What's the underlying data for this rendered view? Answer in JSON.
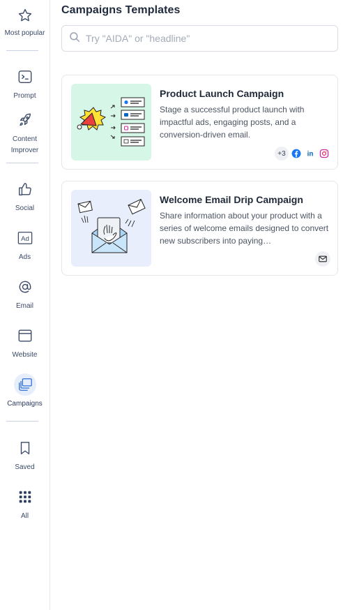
{
  "sidebar": {
    "items": [
      {
        "id": "most-popular",
        "label": "Most popular",
        "icon": "star-icon"
      },
      {
        "id": "prompt",
        "label": "Prompt",
        "icon": "terminal-icon"
      },
      {
        "id": "content-improver",
        "label": "Content Improver",
        "icon": "rocket-icon"
      },
      {
        "id": "social",
        "label": "Social",
        "icon": "thumbs-up-icon"
      },
      {
        "id": "ads",
        "label": "Ads",
        "icon": "ad-icon"
      },
      {
        "id": "email",
        "label": "Email",
        "icon": "at-sign-icon"
      },
      {
        "id": "website",
        "label": "Website",
        "icon": "browser-window-icon"
      },
      {
        "id": "campaigns",
        "label": "Campaigns",
        "icon": "stacked-layers-icon",
        "active": true
      },
      {
        "id": "saved",
        "label": "Saved",
        "icon": "bookmark-icon"
      },
      {
        "id": "all",
        "label": "All",
        "icon": "grid-dots-icon"
      }
    ]
  },
  "main": {
    "title": "Campaigns Templates",
    "search": {
      "placeholder": "Try \"AIDA\" or \"headline\"",
      "value": ""
    },
    "cards": [
      {
        "title": "Product Launch Campaign",
        "description": "Stage a successful product launch with impactful ads, engaging posts, and a conversion-driven email.",
        "more_count": "+3",
        "channels": [
          "facebook-icon",
          "linkedin-icon",
          "instagram-icon"
        ]
      },
      {
        "title": "Welcome Email Drip Campaign",
        "description": "Share information about your product with a series of welcome emails designed to convert new subscribers into paying…",
        "channels": [
          "mail-icon"
        ]
      }
    ]
  },
  "colors": {
    "accent": "#2f6fd6",
    "sidebar_text": "#3b4a66",
    "card1_thumb_bg": "#d6f7e8",
    "card2_thumb_bg": "#e8eefc",
    "facebook": "#1877f2",
    "linkedin": "#0a66c2",
    "instagram": "#d6249f"
  }
}
